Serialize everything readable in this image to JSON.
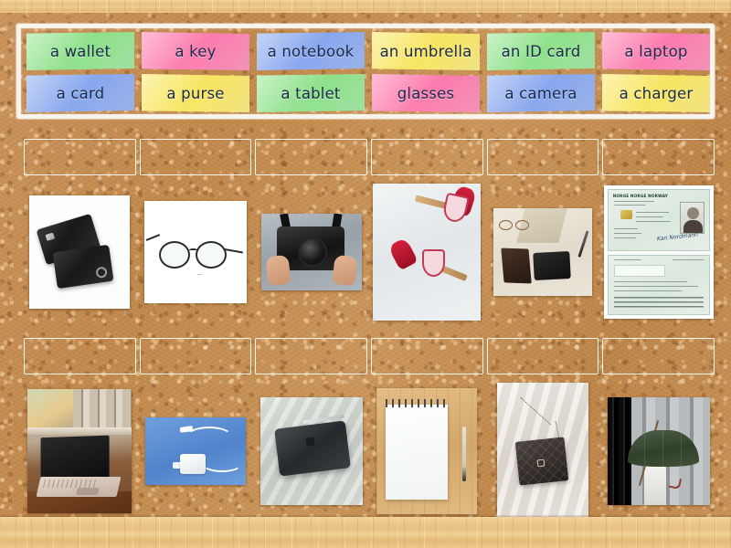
{
  "activity": {
    "type": "match-up",
    "background": "cork-board",
    "frame_color": "#edc98c",
    "board_color": "#c08a4e"
  },
  "word_bank": {
    "rows": [
      [
        {
          "label": "a wallet",
          "color": "green",
          "color_hex": "#8de089"
        },
        {
          "label": "a key",
          "color": "pink",
          "color_hex": "#fb7aac"
        },
        {
          "label": "a notebook",
          "color": "blue",
          "color_hex": "#87a6ee"
        },
        {
          "label": "an umbrella",
          "color": "yellow",
          "color_hex": "#f7e45f"
        },
        {
          "label": "an ID card",
          "color": "green",
          "color_hex": "#8de089"
        },
        {
          "label": "a laptop",
          "color": "pink",
          "color_hex": "#fb7aac"
        }
      ],
      [
        {
          "label": "a card",
          "color": "blue",
          "color_hex": "#87a6ee"
        },
        {
          "label": "a purse",
          "color": "yellow",
          "color_hex": "#f7e45f"
        },
        {
          "label": "a tablet",
          "color": "green",
          "color_hex": "#8de089"
        },
        {
          "label": "glasses",
          "color": "pink",
          "color_hex": "#fb7aac"
        },
        {
          "label": "a camera",
          "color": "blue",
          "color_hex": "#87a6ee"
        },
        {
          "label": "a charger",
          "color": "yellow",
          "color_hex": "#f7e45f"
        }
      ]
    ]
  },
  "answer_rows": [
    {
      "slots": [
        {
          "filled": false,
          "value": ""
        },
        {
          "filled": false,
          "value": ""
        },
        {
          "filled": false,
          "value": ""
        },
        {
          "filled": false,
          "value": ""
        },
        {
          "filled": false,
          "value": ""
        },
        {
          "filled": false,
          "value": ""
        }
      ],
      "pictures": [
        {
          "name": "credit-cards-photo",
          "alt": "two black credit cards on a white background"
        },
        {
          "name": "eyeglasses-photo",
          "alt": "round metal eyeglasses on a white background"
        },
        {
          "name": "camera-photo",
          "alt": "hands holding a black film camera"
        },
        {
          "name": "keys-photo",
          "alt": "two keys with red tassel keyrings on marble"
        },
        {
          "name": "wallet-photo",
          "alt": "black leather wallets with glasses and a pen on a desk"
        },
        {
          "name": "id-card-photo",
          "alt": "Norwegian national ID card front and back"
        }
      ]
    },
    {
      "slots": [
        {
          "filled": false,
          "value": ""
        },
        {
          "filled": false,
          "value": ""
        },
        {
          "filled": false,
          "value": ""
        },
        {
          "filled": false,
          "value": ""
        },
        {
          "filled": false,
          "value": ""
        },
        {
          "filled": false,
          "value": ""
        }
      ],
      "pictures": [
        {
          "name": "laptop-photo",
          "alt": "open laptop on a wooden desk by a window"
        },
        {
          "name": "charger-photo",
          "alt": "white power adapter and cable on a blue background"
        },
        {
          "name": "tablet-photo",
          "alt": "dark grey tablet with a stylus on a bed sheet"
        },
        {
          "name": "notebook-photo",
          "alt": "spiral notepad and pen on a wooden board"
        },
        {
          "name": "purse-photo",
          "alt": "black quilted chain purse on white fabric"
        },
        {
          "name": "umbrella-photo",
          "alt": "person holding a dark green umbrella"
        }
      ]
    }
  ],
  "id_card": {
    "header": "NORGE NORGE NORWAY",
    "signature": "Kari Nordmann"
  }
}
